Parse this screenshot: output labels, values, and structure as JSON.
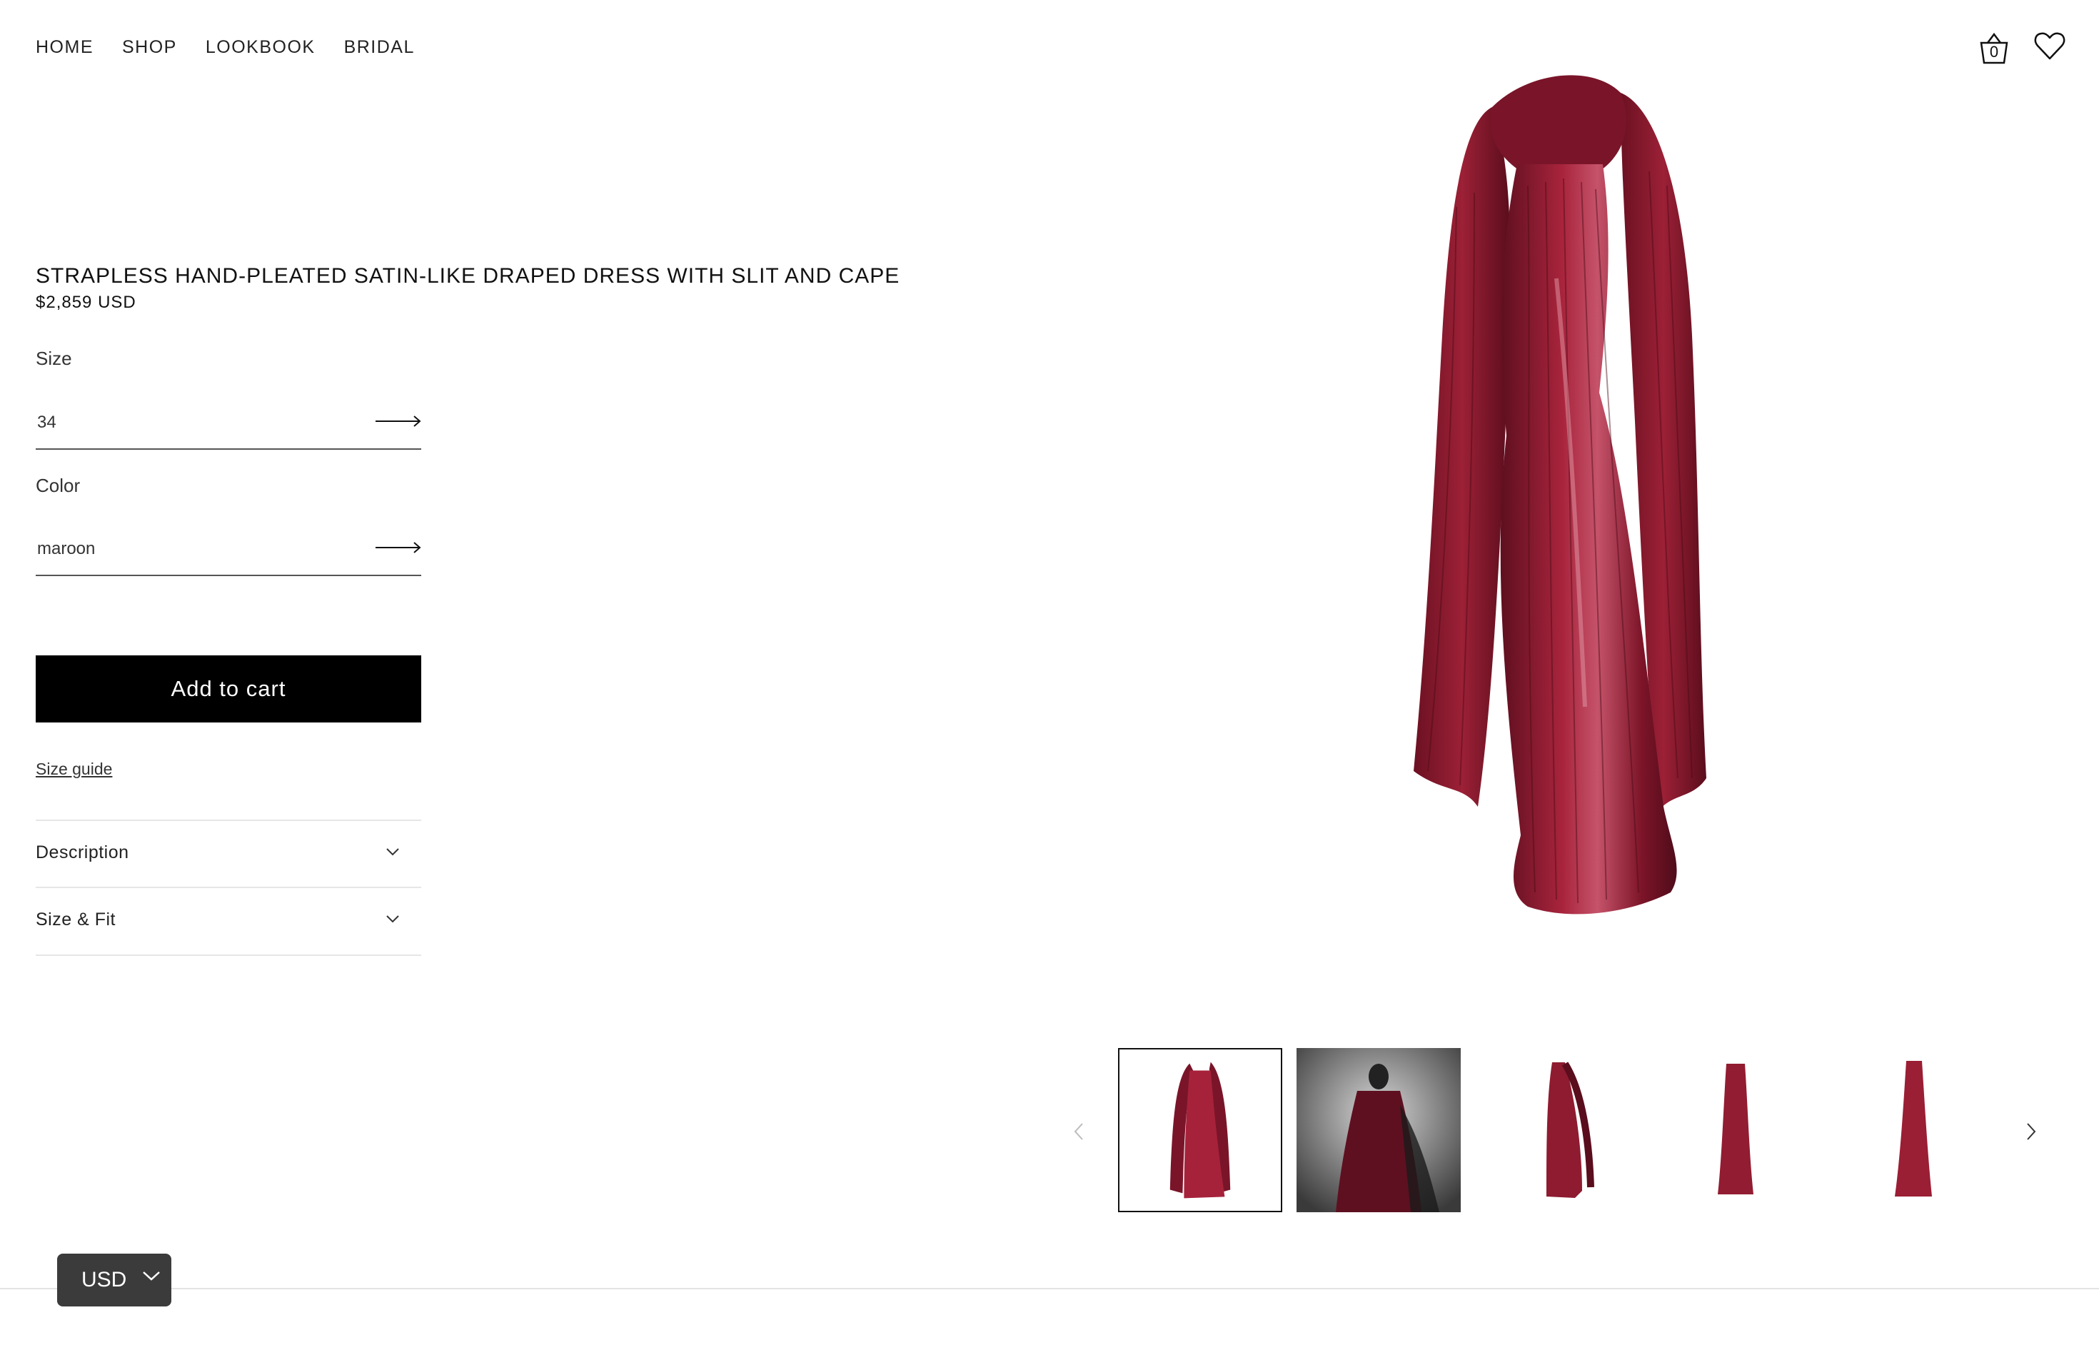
{
  "nav": {
    "items": [
      "HOME",
      "SHOP",
      "LOOKBOOK",
      "BRIDAL"
    ]
  },
  "header": {
    "cart_count": "0",
    "cart_icon": "shopping-bag-icon",
    "wishlist_icon": "heart-icon"
  },
  "product": {
    "title": "STRAPLESS HAND-PLEATED SATIN-LIKE DRAPED DRESS WITH SLIT AND CAPE",
    "price": "$2,859 USD",
    "dress_color": "#8b1a2e",
    "size": {
      "label": "Size",
      "value": "34"
    },
    "color": {
      "label": "Color",
      "value": "maroon"
    },
    "add_to_cart": "Add to cart",
    "size_guide": "Size guide",
    "accordions": [
      "Description",
      "Size & Fit"
    ]
  },
  "gallery": {
    "thumbnail_count": 5,
    "active_index": 0
  },
  "currency": {
    "code": "USD"
  }
}
